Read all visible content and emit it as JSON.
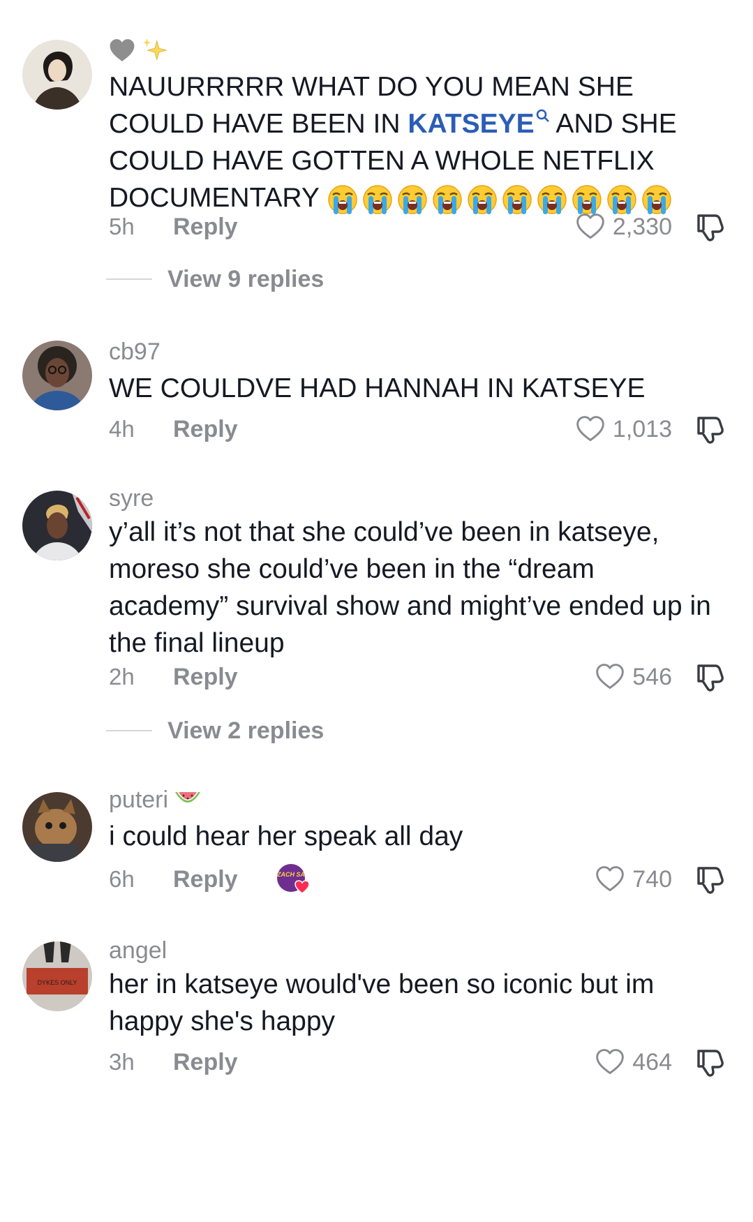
{
  "comments": [
    {
      "username": "",
      "username_icons": [
        "grey-heart-icon",
        "sparkles-icon"
      ],
      "text_before": "NAUURRRRR WHAT DO YOU MEAN SHE COULD HAVE BEEN IN ",
      "keyword": "KATSEYE",
      "text_after": " AND SHE COULD HAVE GOTTEN A WHOLE NETFLIX DOCUMENTARY",
      "emoji": "loudly-crying-face-icon",
      "emoji_count": 10,
      "time": "5h",
      "reply_label": "Reply",
      "likes": "2,330",
      "view_replies": "View 9 replies"
    },
    {
      "username": "cb97",
      "text": "WE COULDVE HAD HANNAH IN KATSEYE",
      "time": "4h",
      "reply_label": "Reply",
      "likes": "1,013"
    },
    {
      "username": "syre",
      "text": "y’all it’s not that she could’ve been in katseye, moreso she could’ve been in the “dream academy” survival show and might’ve ended up in the final lineup",
      "time": "2h",
      "reply_label": "Reply",
      "likes": "546",
      "view_replies": "View 2 replies"
    },
    {
      "username": "puteri",
      "username_icons": [
        "watermelon-icon"
      ],
      "text": "i could hear her speak all day",
      "time": "6h",
      "reply_label": "Reply",
      "creator_badge_text": "ZACH SA",
      "likes": "740"
    },
    {
      "username": "angel",
      "text": "her in katseye would've been so iconic but im happy she's happy",
      "time": "3h",
      "reply_label": "Reply",
      "likes": "464"
    }
  ],
  "avatar_doormat_text": "DYKES ONLY",
  "colors": {
    "text": "#161823",
    "muted": "#8a8b91",
    "keyword": "#2b5db6"
  }
}
